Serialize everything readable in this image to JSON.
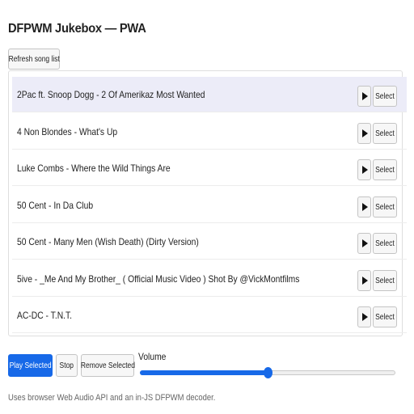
{
  "app": {
    "title": "DFPWM Jukebox — PWA"
  },
  "toolbar": {
    "refresh_label": "Refresh song list"
  },
  "songs": [
    {
      "name": "2Pac ft. Snoop Dogg - 2 Of Amerikaz Most Wanted",
      "select_label": "Select",
      "selected": true
    },
    {
      "name": "4 Non Blondes - What's Up",
      "select_label": "Select",
      "selected": false
    },
    {
      "name": "Luke Combs - Where the Wild Things Are",
      "select_label": "Select",
      "selected": false
    },
    {
      "name": "50 Cent - In Da Club",
      "select_label": "Select",
      "selected": false
    },
    {
      "name": "50 Cent - Many Men (Wish Death) (Dirty Version)",
      "select_label": "Select",
      "selected": false
    },
    {
      "name": "5ive - _Me And My Brother_ ( Official Music Video ) Shot By @VickMontfilms",
      "select_label": "Select",
      "selected": false
    },
    {
      "name": "AC-DC - T.N.T.",
      "select_label": "Select",
      "selected": false
    }
  ],
  "controls": {
    "play_selected_label": "Play Selected",
    "stop_label": "Stop",
    "remove_selected_label": "Remove Selected",
    "volume_label": "Volume",
    "volume_value": 0.5
  },
  "footer": {
    "note": "Uses browser Web Audio API and an in-JS DFPWM decoder."
  },
  "colors": {
    "accent": "#1769e8",
    "selected_row": "#ececf8"
  },
  "icons": {
    "play": "play-icon"
  }
}
